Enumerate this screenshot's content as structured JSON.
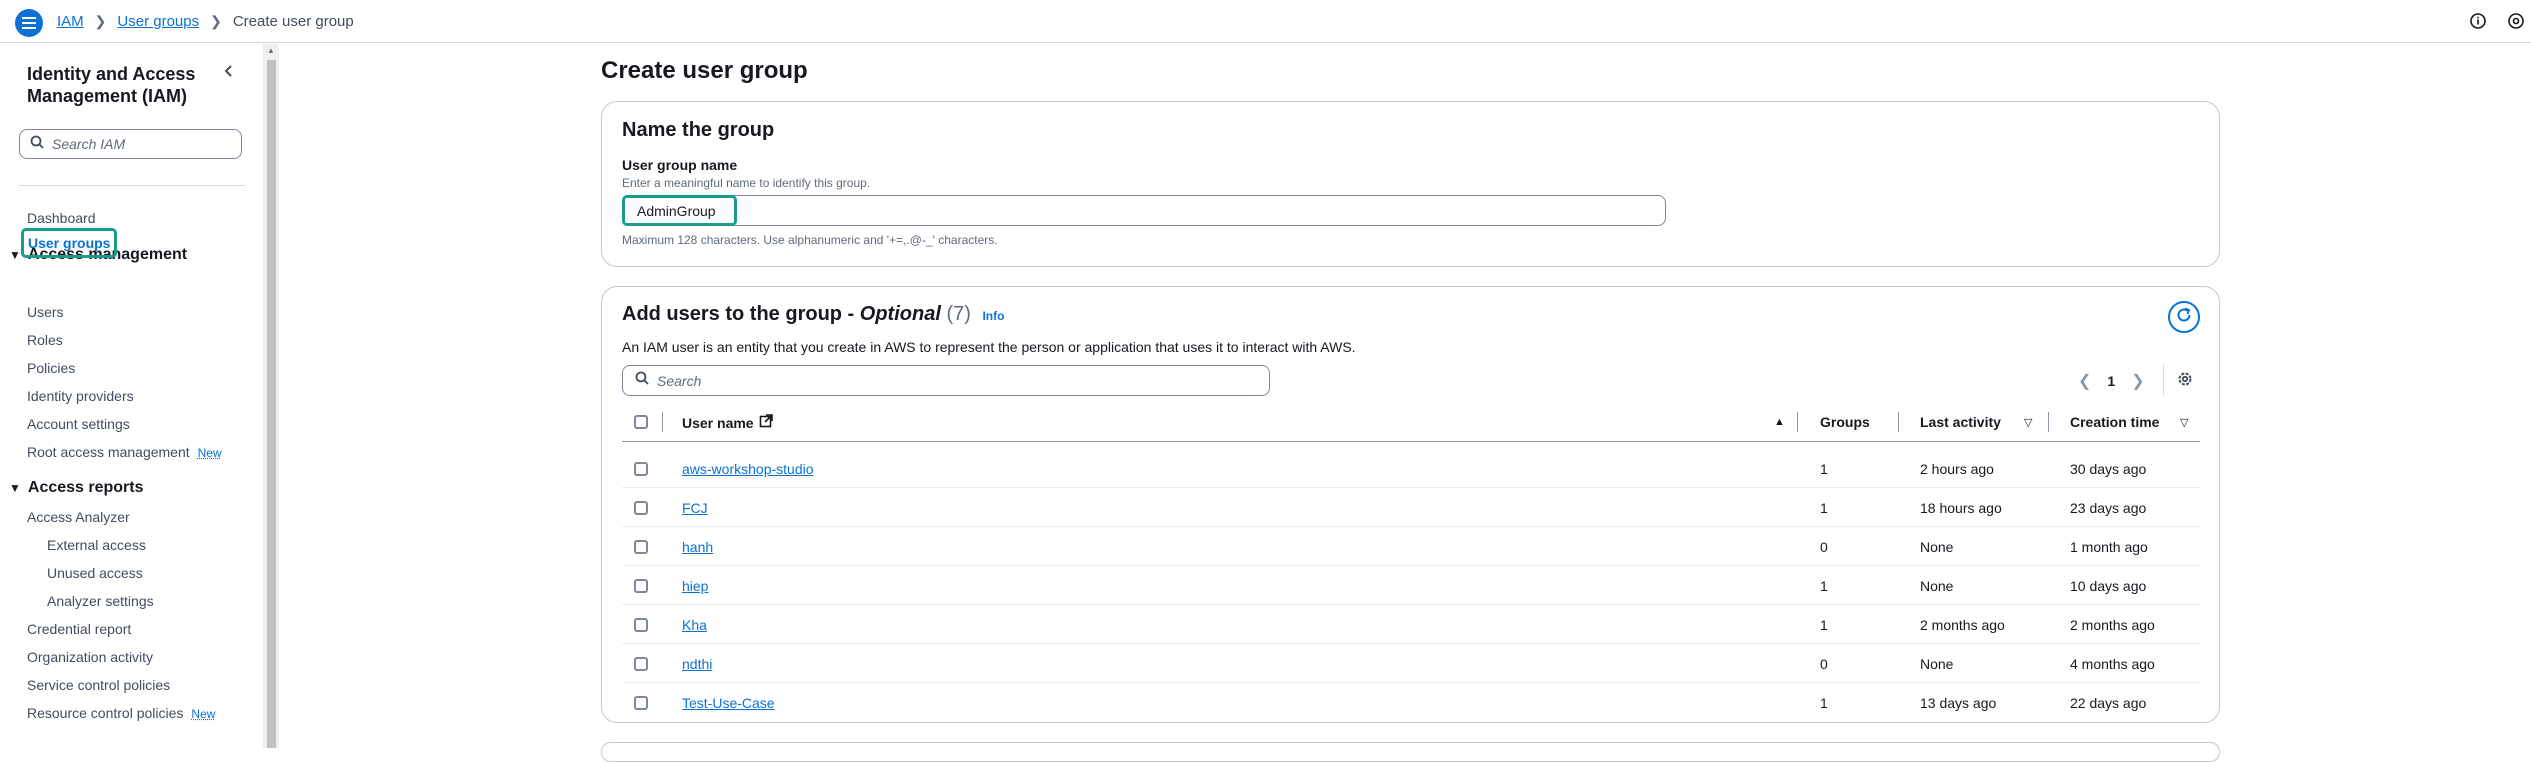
{
  "breadcrumb": {
    "root": "IAM",
    "parent": "User groups",
    "current": "Create user group"
  },
  "sidebar": {
    "title": "Identity and Access Management (IAM)",
    "search_placeholder": "Search IAM",
    "dashboard": "Dashboard",
    "access_management": {
      "heading": "Access management",
      "items": [
        "User groups",
        "Users",
        "Roles",
        "Policies",
        "Identity providers",
        "Account settings",
        "Root access management"
      ],
      "root_access_badge": "New"
    },
    "access_reports": {
      "heading": "Access reports",
      "items": [
        "Access Analyzer",
        "External access",
        "Unused access",
        "Analyzer settings",
        "Credential report",
        "Organization activity",
        "Service control policies",
        "Resource control policies"
      ],
      "resource_control_badge": "New"
    }
  },
  "page": {
    "title": "Create user group"
  },
  "name_panel": {
    "title": "Name the group",
    "label": "User group name",
    "description": "Enter a meaningful name to identify this group.",
    "value": "AdminGroup",
    "hint": "Maximum 128 characters. Use alphanumeric and '+=,.@-_' characters."
  },
  "users_panel": {
    "title": "Add users to the group - ",
    "optional": "Optional",
    "count": "(7)",
    "info": "Info",
    "description": "An IAM user is an entity that you create in AWS to represent the person or application that uses it to interact with AWS.",
    "search_placeholder": "Search",
    "page_number": "1",
    "columns": {
      "user_name": "User name",
      "groups": "Groups",
      "last_activity": "Last activity",
      "creation_time": "Creation time"
    },
    "rows": [
      {
        "user_name": "aws-workshop-studio",
        "groups": "1",
        "last_activity": "2 hours ago",
        "creation_time": "30 days ago"
      },
      {
        "user_name": "FCJ",
        "groups": "1",
        "last_activity": "18 hours ago",
        "creation_time": "23 days ago"
      },
      {
        "user_name": "hanh",
        "groups": "0",
        "last_activity": "None",
        "creation_time": "1 month ago"
      },
      {
        "user_name": "hiep",
        "groups": "1",
        "last_activity": "None",
        "creation_time": "10 days ago"
      },
      {
        "user_name": "Kha",
        "groups": "1",
        "last_activity": "2 months ago",
        "creation_time": "2 months ago"
      },
      {
        "user_name": "ndthi",
        "groups": "0",
        "last_activity": "None",
        "creation_time": "4 months ago"
      },
      {
        "user_name": "Test-Use-Case",
        "groups": "1",
        "last_activity": "13 days ago",
        "creation_time": "22 days ago"
      }
    ]
  },
  "colors": {
    "accent": "#0972d3",
    "highlight": "#1a9c8c"
  }
}
